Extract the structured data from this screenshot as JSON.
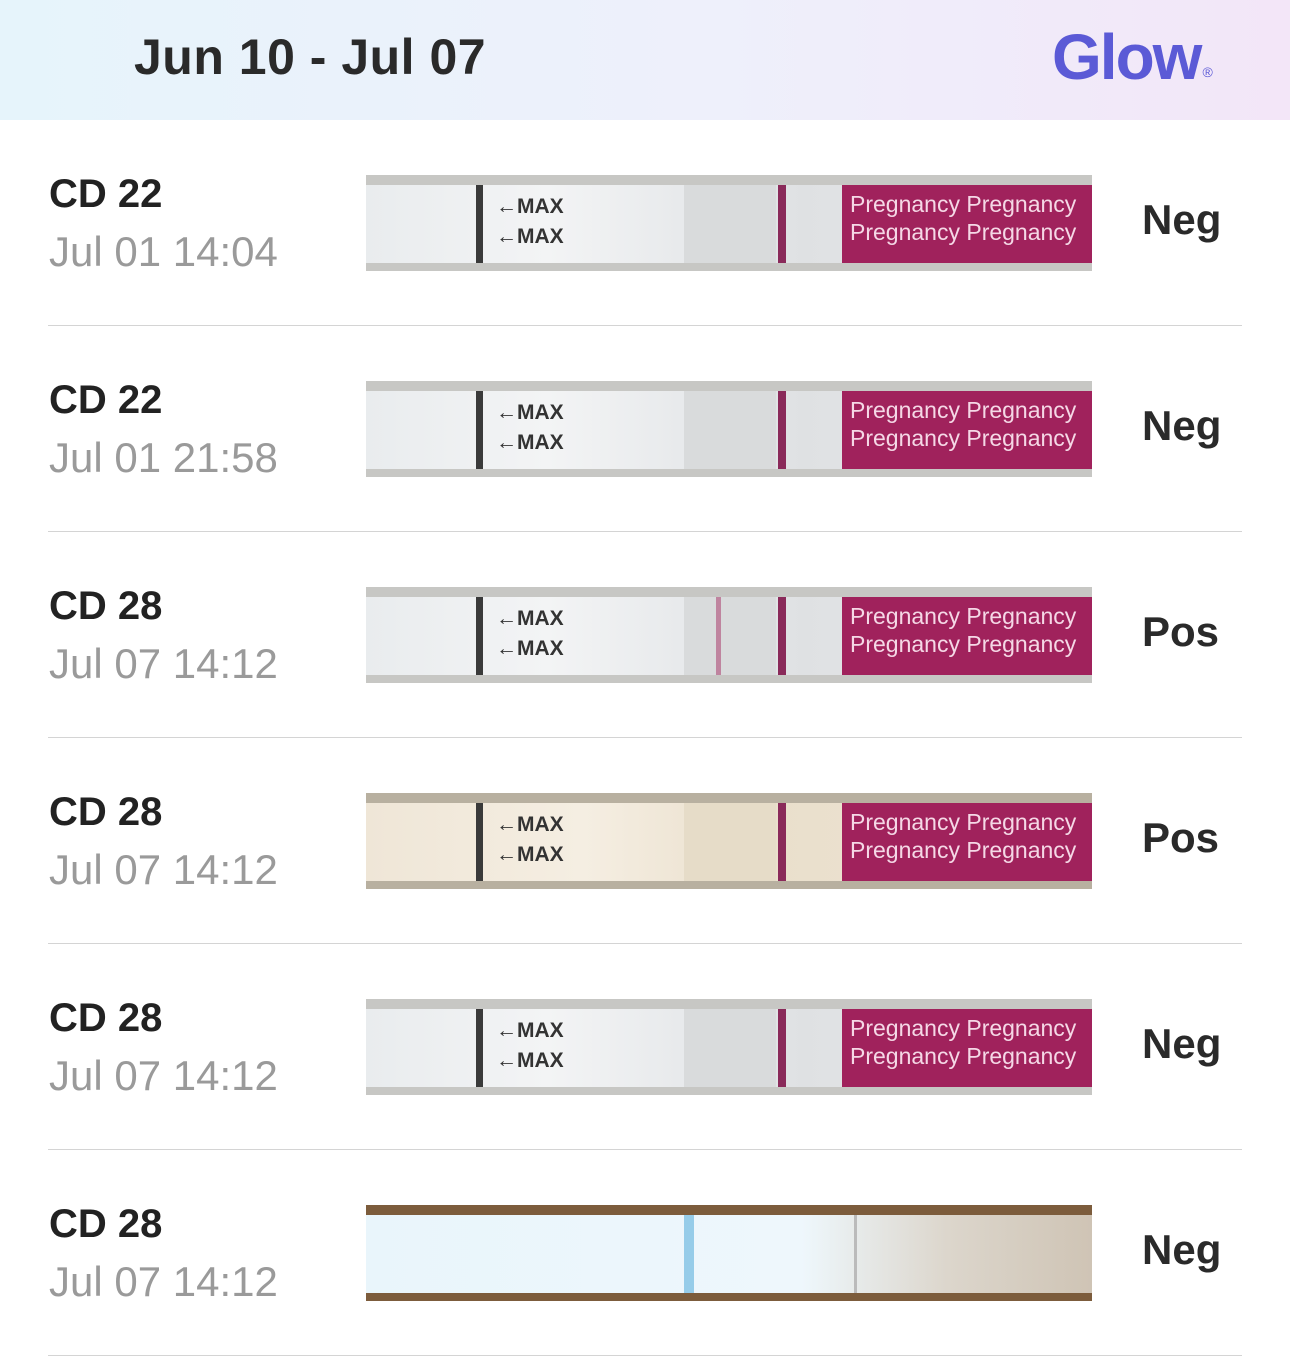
{
  "header": {
    "date_range": "Jun 10 - Jul 07",
    "brand": "Glow",
    "brand_mark": "®",
    "colors": {
      "brand": "#5b5ad6"
    }
  },
  "strip_text": {
    "max": "←MAX",
    "pregnancy": "Pregnancy Pregnancy"
  },
  "tests": [
    {
      "cycle_day": "CD 22",
      "timestamp": "Jul 01 14:04",
      "result": "Neg",
      "strip_style": "neutral"
    },
    {
      "cycle_day": "CD 22",
      "timestamp": "Jul 01 21:58",
      "result": "Neg",
      "strip_style": "neutral"
    },
    {
      "cycle_day": "CD 28",
      "timestamp": "Jul 07 14:12",
      "result": "Pos",
      "strip_style": "pos"
    },
    {
      "cycle_day": "CD 28",
      "timestamp": "Jul 07 14:12",
      "result": "Pos",
      "strip_style": "warm"
    },
    {
      "cycle_day": "CD 28",
      "timestamp": "Jul 07 14:12",
      "result": "Neg",
      "strip_style": "neutral"
    },
    {
      "cycle_day": "CD 28",
      "timestamp": "Jul 07 14:12",
      "result": "Neg",
      "strip_style": "blue"
    }
  ]
}
